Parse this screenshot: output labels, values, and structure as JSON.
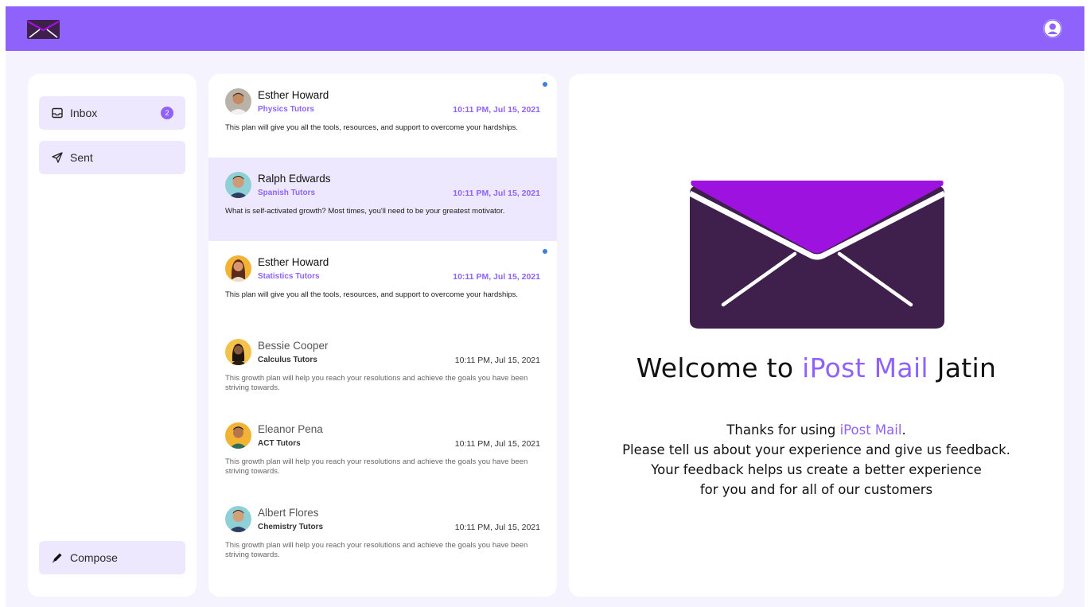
{
  "colors": {
    "brand": "#8e62fb",
    "selected_bg": "#ede8fd",
    "unread_dot": "#3b82d6",
    "envelope_dark": "#3f1f4b",
    "envelope_flap": "#9e12e0"
  },
  "header": {
    "logo_icon": "envelope-icon",
    "profile_icon": "user-avatar-icon"
  },
  "sidebar": {
    "items": [
      {
        "label": "Inbox",
        "icon": "inbox-tray-icon",
        "badge": "2"
      },
      {
        "label": "Sent",
        "icon": "send-plane-icon"
      }
    ],
    "compose_label": "Compose",
    "compose_icon": "pencil-icon"
  },
  "mails": [
    {
      "name": "Esther Howard",
      "subject": "Physics Tutors",
      "time": "10:11 PM, Jul 15, 2021",
      "preview": "This plan will give you all the tools, resources, and support to overcome your hardships.",
      "unread": true,
      "selected": false
    },
    {
      "name": "Ralph Edwards",
      "subject": "Spanish Tutors",
      "time": "10:11 PM, Jul 15, 2021",
      "preview": "What is self-activated growth? Most times, you'll need to be your greatest motivator.",
      "unread": false,
      "selected": true
    },
    {
      "name": "Esther Howard",
      "subject": "Statistics Tutors",
      "time": "10:11 PM, Jul 15, 2021",
      "preview": "This plan will give you all the tools, resources, and support to overcome your hardships.",
      "unread": true,
      "selected": false
    },
    {
      "name": "Bessie Cooper",
      "subject": "Calculus Tutors",
      "time": "10:11 PM, Jul 15, 2021",
      "preview": "This growth plan will help you reach your resolutions and achieve the goals you have been striving towards.",
      "unread": false,
      "selected": false
    },
    {
      "name": "Eleanor Pena",
      "subject": "ACT Tutors",
      "time": "10:11 PM, Jul 15, 2021",
      "preview": "This growth plan will help you reach your resolutions and achieve the goals you have been striving towards.",
      "unread": false,
      "selected": false
    },
    {
      "name": "Albert Flores",
      "subject": "Chemistry Tutors",
      "time": "10:11 PM, Jul 15, 2021",
      "preview": "This growth plan will help you reach your resolutions and achieve the goals you have been striving towards.",
      "unread": false,
      "selected": false
    }
  ],
  "welcome": {
    "prefix": "Welcome to ",
    "brand": "iPost Mail",
    "suffix": " Jatin",
    "thanks_prefix": "Thanks for using ",
    "thanks_brand": "iPost Mail",
    "thanks_suffix": ".",
    "line2": "Please tell us about your experience and give us feedback.",
    "line3": "Your feedback helps us create a better experience",
    "line4": "for you and for all of our customers"
  }
}
